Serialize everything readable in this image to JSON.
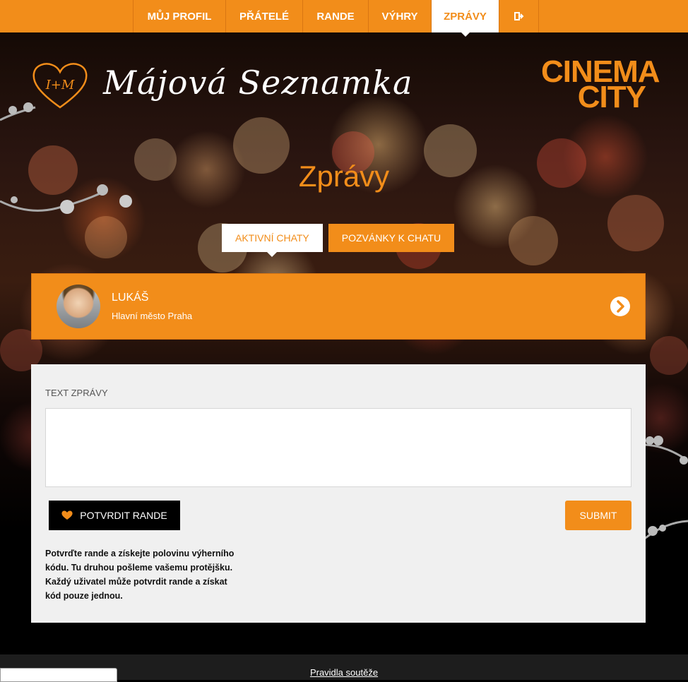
{
  "nav": {
    "items": [
      {
        "label": "MŮJ PROFIL",
        "active": false
      },
      {
        "label": "PŘÁTELÉ",
        "active": false
      },
      {
        "label": "RANDE",
        "active": false
      },
      {
        "label": "VÝHRY",
        "active": false
      },
      {
        "label": "ZPRÁVY",
        "active": true
      }
    ],
    "logout_icon": "sign-out-icon"
  },
  "branding": {
    "heart_text": "I+M",
    "site_name": "Májová Seznamka",
    "partner_line1": "CINEMA",
    "partner_line2": "CITY"
  },
  "page": {
    "title": "Zprávy"
  },
  "tabs": [
    {
      "label": "AKTIVNÍ CHATY",
      "active": true
    },
    {
      "label": "POZVÁNKY K CHATU",
      "active": false
    }
  ],
  "chat": {
    "name": "LUKÁŠ",
    "location": "Hlavní město Praha",
    "arrow_icon": "chevron-right-circle-icon"
  },
  "message_form": {
    "label": "TEXT ZPRÁVY",
    "value": "",
    "confirm_label": "POTVRDIT RANDE",
    "confirm_icon": "heart-icon",
    "submit_label": "SUBMIT",
    "note": "Potvrďte rande a získejte polovinu výherního kódu. Tu druhou pošleme vašemu protějšku. Každý uživatel může potvrdit rande a získat kód pouze jednou."
  },
  "footer": {
    "rules_link": "Pravidla soutěže"
  },
  "colors": {
    "accent": "#f28d1a",
    "panel": "#f0f0f0",
    "dark": "#000000"
  }
}
